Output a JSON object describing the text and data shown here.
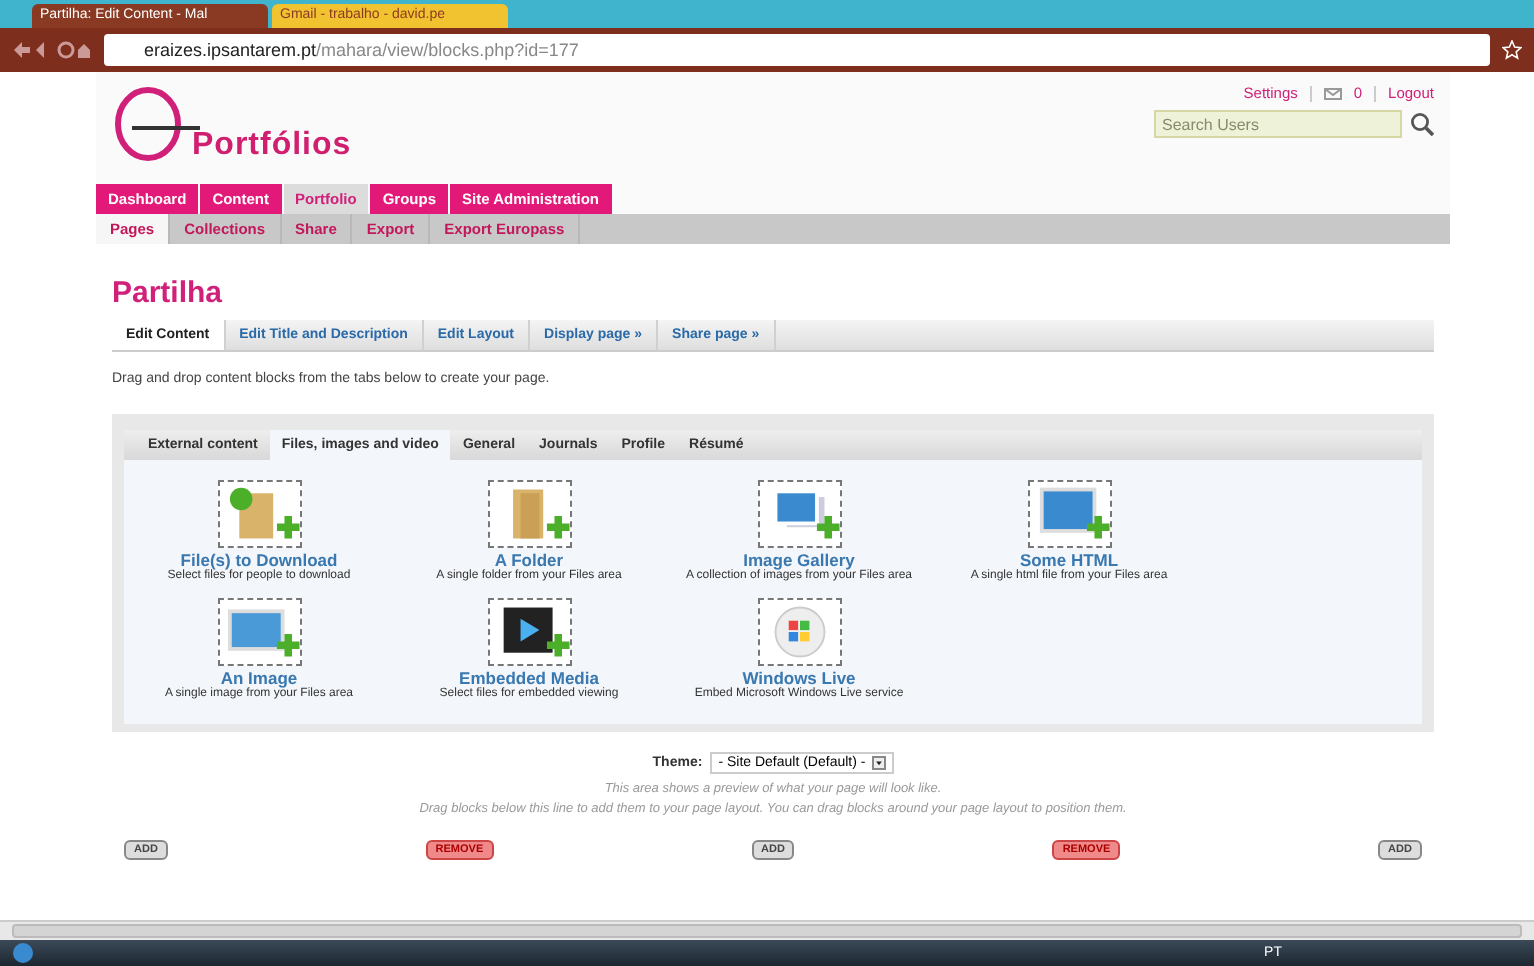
{
  "browser": {
    "tabs": [
      {
        "title": "Partilha: Edit Content - Mal",
        "selected": true
      },
      {
        "title": "Gmail - trabalho - david.pe",
        "selected": false
      }
    ],
    "url": {
      "host": "eraizes.ipsantarem.pt",
      "path": "/mahara/view/blocks.php?id=177"
    }
  },
  "header": {
    "logo": "Portfólios",
    "settings": "Settings",
    "messages": "0",
    "logout": "Logout",
    "search": {
      "placeholder": "Search Users"
    }
  },
  "nav": [
    {
      "label": "Dashboard",
      "selected": false
    },
    {
      "label": "Content",
      "selected": false
    },
    {
      "label": "Portfolio",
      "selected": true
    },
    {
      "label": "Groups",
      "selected": false
    },
    {
      "label": "Site Administration",
      "selected": false
    }
  ],
  "subnav": [
    {
      "label": "Pages",
      "selected": true
    },
    {
      "label": "Collections",
      "selected": false
    },
    {
      "label": "Share",
      "selected": false
    },
    {
      "label": "Export",
      "selected": false
    },
    {
      "label": "Export Europass",
      "selected": false
    }
  ],
  "title": "Partilha",
  "page_tabs": [
    {
      "label": "Edit Content",
      "selected": true
    },
    {
      "label": "Edit Title and Description",
      "selected": false
    },
    {
      "label": "Edit Layout",
      "selected": false
    },
    {
      "label": "Display page »",
      "selected": false
    },
    {
      "label": "Share page »",
      "selected": false
    }
  ],
  "instructions": "Drag and drop content blocks from the tabs below to create your page.",
  "block_tabs": [
    {
      "label": "External content",
      "selected": false
    },
    {
      "label": "Files, images and video",
      "selected": true
    },
    {
      "label": "General",
      "selected": false
    },
    {
      "label": "Journals",
      "selected": false
    },
    {
      "label": "Profile",
      "selected": false
    },
    {
      "label": "Résumé",
      "selected": false
    }
  ],
  "blocks": [
    {
      "kind": "download",
      "title": "File(s) to Download",
      "description": "Select files for people to download"
    },
    {
      "kind": "folder",
      "title": "A Folder",
      "description": "A single folder from your Files area"
    },
    {
      "kind": "gallery",
      "title": "Image Gallery",
      "description": "A collection of images from your Files area"
    },
    {
      "kind": "html",
      "title": "Some HTML",
      "description": "A single html file from your Files area"
    },
    {
      "kind": "image",
      "title": "An Image",
      "description": "A single image from your Files area"
    },
    {
      "kind": "media",
      "title": "Embedded Media",
      "description": "Select files for embedded viewing"
    },
    {
      "kind": "windows",
      "title": "Windows Live",
      "description": "Embed Microsoft Windows Live service"
    }
  ],
  "theme": {
    "label": "Theme:",
    "value": "- Site Default (Default) -"
  },
  "preview_notes": [
    "This area shows a preview of what your page will look like.",
    "Drag blocks below this line to add them to your page layout. You can drag blocks around your page layout to position them."
  ],
  "column_buttons": [
    {
      "kind": "add",
      "label": "ADD"
    },
    {
      "kind": "remove",
      "label": "REMOVE"
    },
    {
      "kind": "add",
      "label": "ADD"
    },
    {
      "kind": "remove",
      "label": "REMOVE"
    },
    {
      "kind": "add",
      "label": "ADD"
    }
  ],
  "taskbar": {
    "language": "PT"
  }
}
